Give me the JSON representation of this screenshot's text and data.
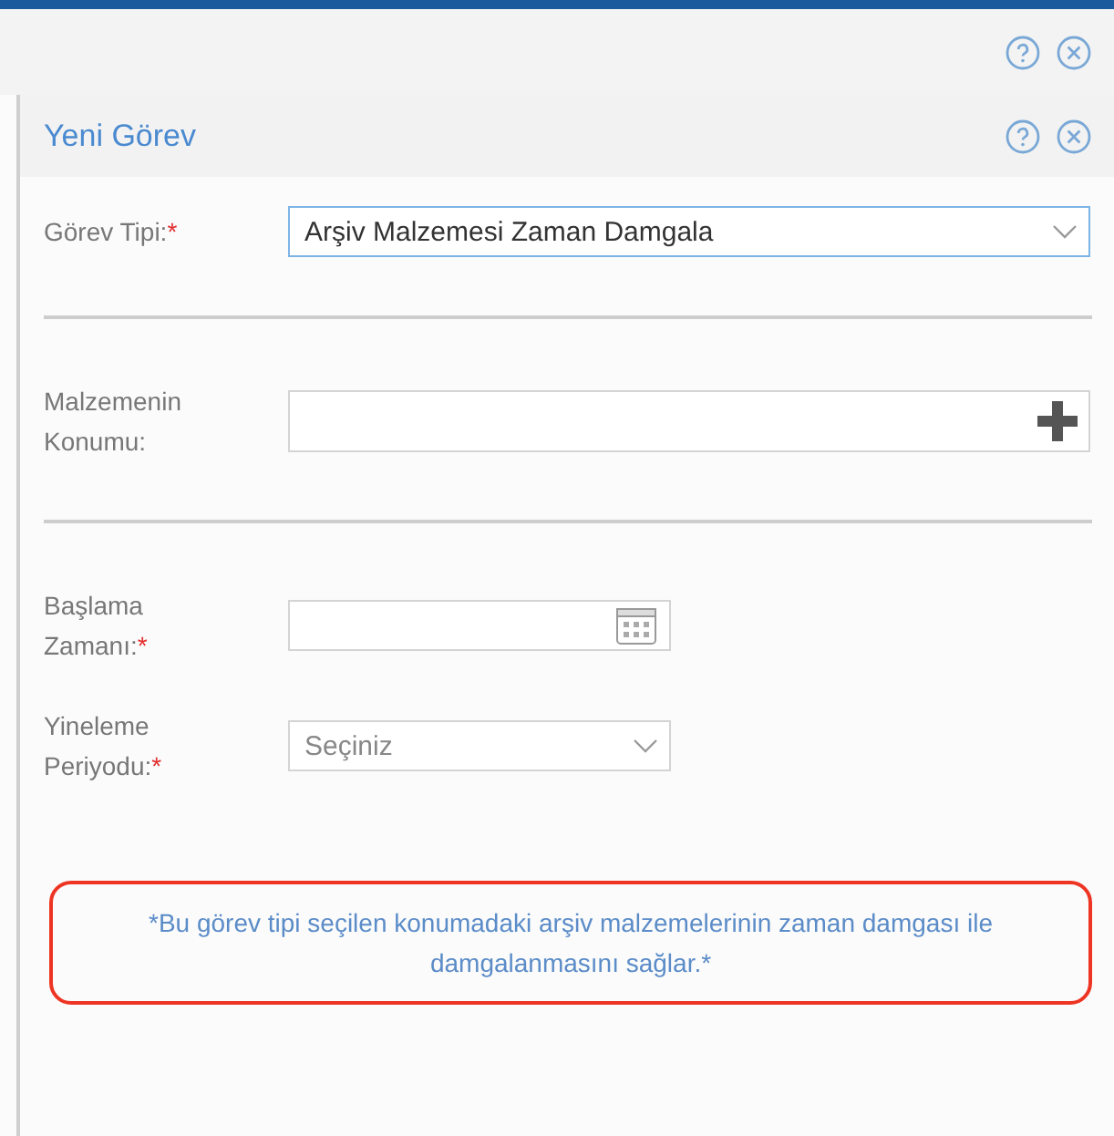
{
  "panel": {
    "title": "Yeni Görev"
  },
  "sections": [
    {
      "fields": [
        {
          "kind": "select",
          "label": "Görev Tipi:",
          "required_mark": "*",
          "value": "Arşiv Malzemesi Zaman Damgala",
          "focused": true
        }
      ]
    },
    {
      "fields": [
        {
          "kind": "lookup",
          "label": "Malzemenin Konumu:",
          "focused": false
        }
      ]
    },
    {
      "fields": [
        {
          "kind": "date",
          "label": "Başlama Zamanı:",
          "required_mark": "*",
          "focused": false
        },
        {
          "kind": "select",
          "label": "Yineleme Periyodu:",
          "required_mark": "*",
          "placeholder": "Seçiniz",
          "focused": false
        }
      ]
    }
  ],
  "note": "*Bu görev tipi seçilen konumadaki arşiv malzemelerinin zaman damgası ile damgalanmasını sağlar.*"
}
